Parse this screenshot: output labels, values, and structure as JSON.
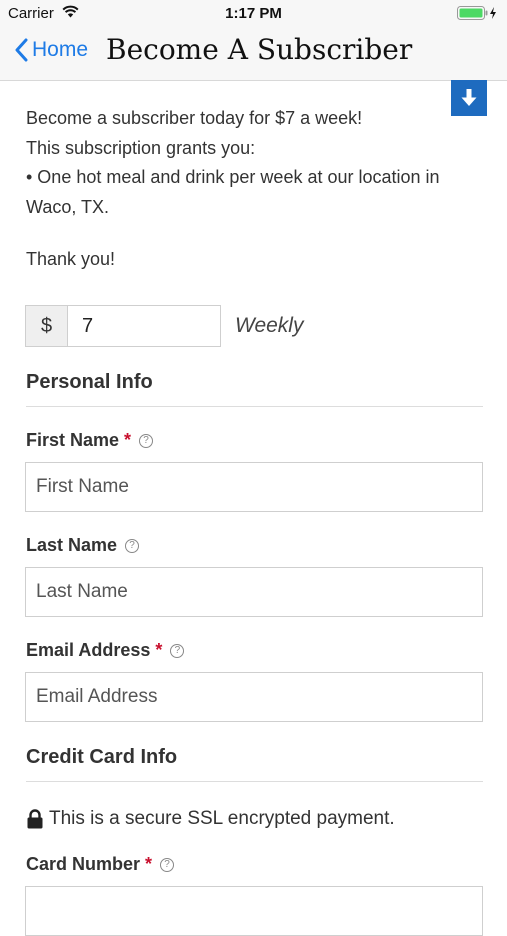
{
  "status": {
    "carrier": "Carrier",
    "time": "1:17 PM"
  },
  "nav": {
    "back_label": "Home",
    "title": "Become A Subscriber"
  },
  "intro": {
    "line1": "Become a subscriber today for $7 a week!",
    "line2": "This subscription grants you:",
    "line3": "• One hot meal and drink per week at our location in",
    "line4": "Waco, TX.",
    "thanks": "Thank you!"
  },
  "amount": {
    "prefix": "$",
    "value": "7",
    "period": "Weekly"
  },
  "personal": {
    "title": "Personal Info",
    "first_name": {
      "label": "First Name",
      "required": "*",
      "placeholder": "First Name"
    },
    "last_name": {
      "label": "Last Name",
      "placeholder": "Last Name"
    },
    "email": {
      "label": "Email Address",
      "required": "*",
      "placeholder": "Email Address"
    }
  },
  "credit": {
    "title": "Credit Card Info",
    "secure_text": "This is a secure SSL encrypted payment.",
    "card_number": {
      "label": "Card Number",
      "required": "*"
    }
  },
  "help_glyph": "?",
  "colors": {
    "accent": "#1e7be6",
    "download_button": "#1e6bbf",
    "required": "#c8102e",
    "battery": "#4cd964"
  },
  "icons": {
    "back": "chevron-left-icon",
    "download": "arrow-down-icon",
    "lock": "lock-icon",
    "help": "question-circle-icon"
  }
}
